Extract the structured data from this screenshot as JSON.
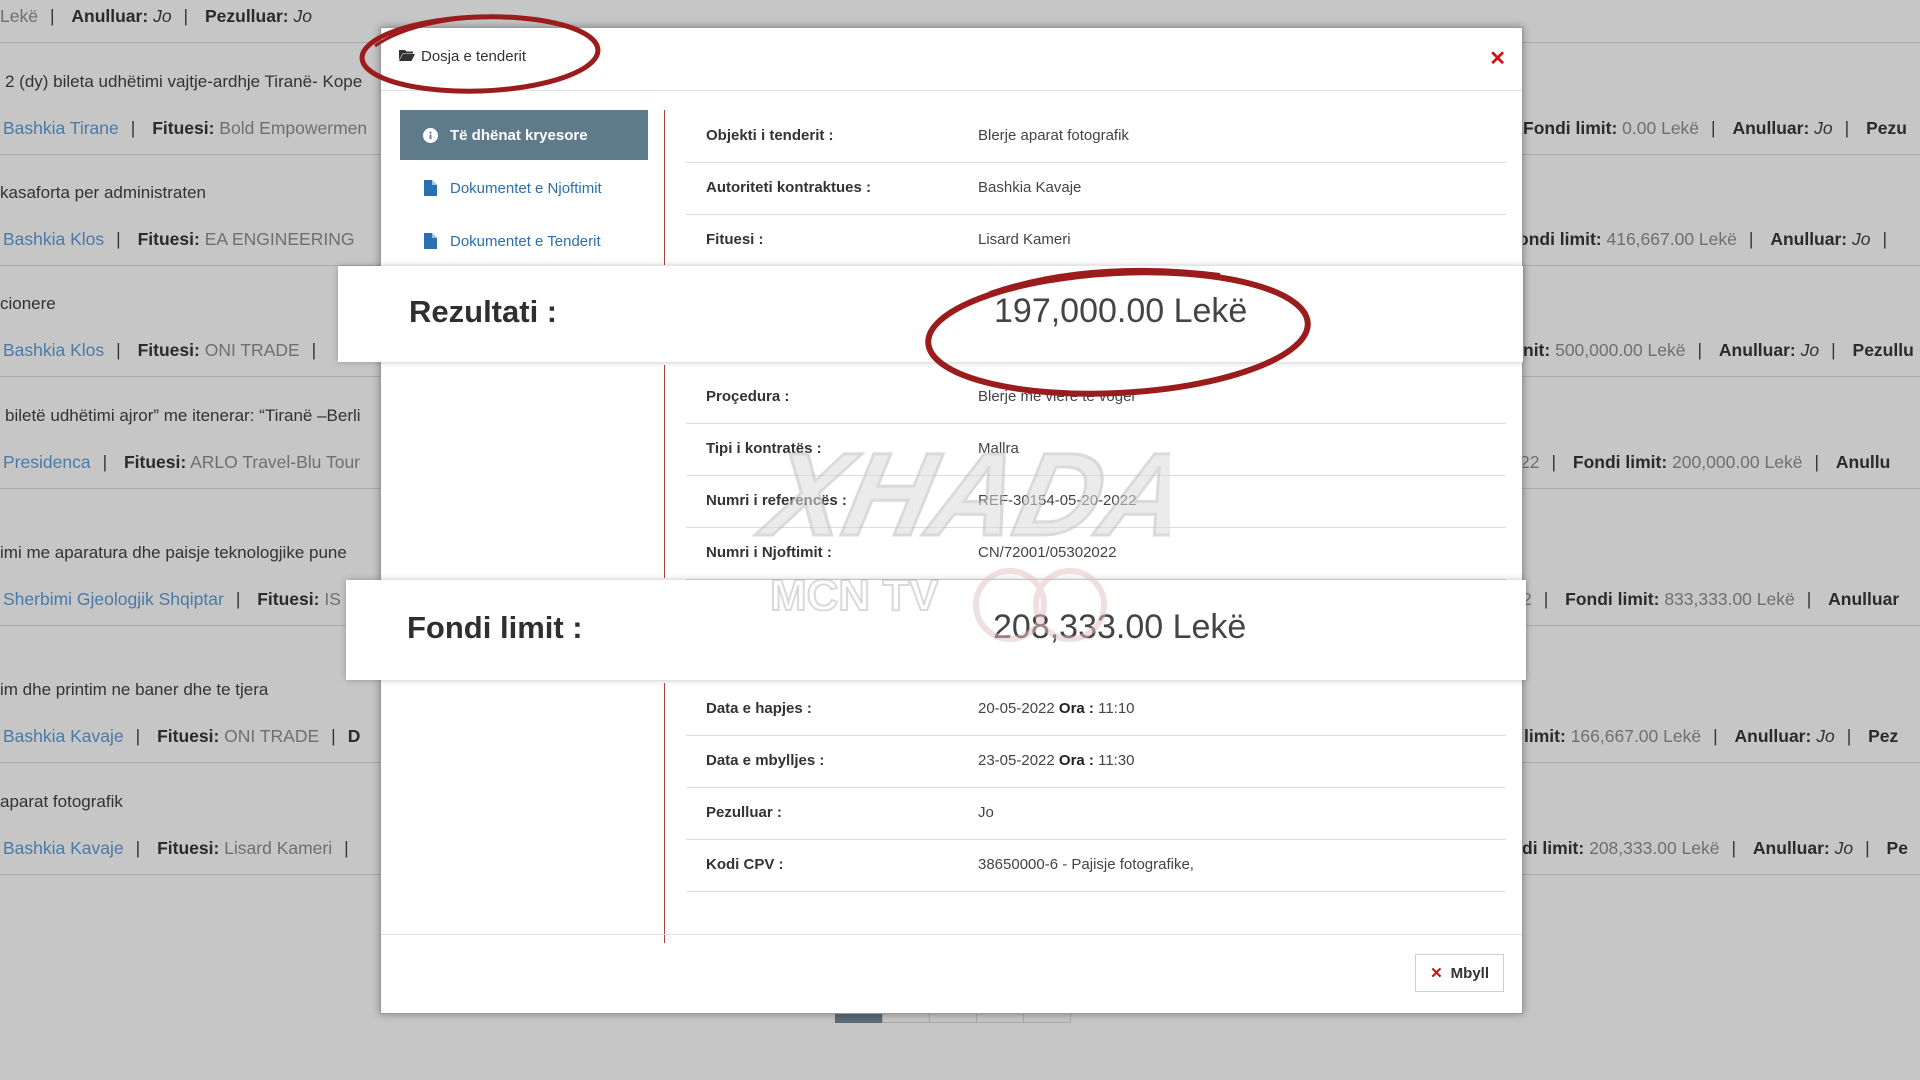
{
  "background": {
    "rows": [
      {
        "title": "",
        "authority": "",
        "winner": "",
        "meta_prefix": "Lekë",
        "anulluar_label": "Anulluar:",
        "anulluar_value": "Jo",
        "pezulluar_label": "Pezulluar:",
        "pezulluar_value": "Jo"
      },
      {
        "title": "2 (dy) bileta udhëtimi vajtje-ardhje Tiranë- Kope",
        "authority": "Bashkia Tirane",
        "winner_label": "Fituesi:",
        "winner": "Bold Empowermen",
        "fondi_label": "Fondi limit:",
        "fondi_value": "0.00 Lekë",
        "anulluar_label": "Anulluar:",
        "anulluar_value": "Jo",
        "pezulluar_label": "Pezu"
      },
      {
        "title": "kasaforta per administraten",
        "authority": "Bashkia Klos",
        "winner_label": "Fituesi:",
        "winner": "EA ENGINEERING",
        "fondi_label": "ondi limit:",
        "fondi_value": "416,667.00 Lekë",
        "anulluar_label": "Anulluar:",
        "anulluar_value": "Jo"
      },
      {
        "title": "cionere",
        "authority": "Bashkia Klos",
        "winner_label": "Fituesi:",
        "winner": "ONI TRADE",
        "fondi_label": "nit:",
        "fondi_value": "500,000.00 Lekë",
        "anulluar_label": "Anulluar:",
        "anulluar_value": "Jo",
        "pezulluar_label": "Pezullu"
      },
      {
        "title": "biletë udhëtimi ajror” me itenerar: “Tiranë –Berli",
        "authority": "Presidenca",
        "winner_label": "Fituesi:",
        "winner": "ARLO Travel-Blu Tour",
        "fondi_prefix": "22",
        "fondi_label": "Fondi limit:",
        "fondi_value": "200,000.00 Lekë",
        "anulluar_label": "Anullu"
      },
      {
        "title": "imi me aparatura dhe paisje teknologjike pune",
        "authority": "Sherbimi Gjeologjik Shqiptar",
        "winner_label": "Fituesi:",
        "winner": "IS",
        "fondi_prefix": "2",
        "fondi_label": "Fondi limit:",
        "fondi_value": "833,333.00 Lekë",
        "anulluar_label": "Anulluar"
      },
      {
        "title": "im dhe printim ne baner dhe te tjera",
        "authority": "Bashkia Kavaje",
        "winner_label": "Fituesi:",
        "winner": "ONI TRADE",
        "extra": "D",
        "fondi_label": "limit:",
        "fondi_value": "166,667.00 Lekë",
        "anulluar_label": "Anulluar:",
        "anulluar_value": "Jo",
        "pezulluar_label": "Pez"
      },
      {
        "title": "aparat fotografik",
        "authority": "Bashkia Kavaje",
        "winner_label": "Fituesi:",
        "winner": "Lisard Kameri",
        "fondi_label": "di limit:",
        "fondi_value": "208,333.00 Lekë",
        "anulluar_label": "Anulluar:",
        "anulluar_value": "Jo",
        "pezulluar_label": "Pe"
      }
    ]
  },
  "modal": {
    "title": "Dosja e tenderit",
    "close_glyph": "✕",
    "nav": [
      {
        "label": "Të dhënat kryesore",
        "icon": "info-circle-icon",
        "active": true
      },
      {
        "label": "Dokumentet e Njoftimit",
        "icon": "document-icon",
        "active": false
      },
      {
        "label": "Dokumentet e Tenderit",
        "icon": "document-icon",
        "active": false
      }
    ],
    "details_top": [
      {
        "label": "Objekti i tenderit :",
        "value": "Blerje aparat fotografik"
      },
      {
        "label": "Autoriteti kontraktues :",
        "value": "Bashkia Kavaje"
      },
      {
        "label": "Fituesi :",
        "value": "Lisard Kameri"
      }
    ],
    "details_mid": [
      {
        "label": "Proçedura :",
        "value": "Blerje me vlerë të vogël"
      },
      {
        "label": "Tipi i kontratës :",
        "value": "Mallra"
      },
      {
        "label": "Numri i referencës :",
        "value": "REF-30154-05-20-2022"
      },
      {
        "label": "Numri i Njoftimit :",
        "value": "CN/72001/05302022"
      }
    ],
    "details_bottom": [
      {
        "label": "Data e hapjes :",
        "date": "20-05-2022",
        "ora_label": "Ora :",
        "time": "11:10"
      },
      {
        "label": "Data e mbylljes :",
        "date": "23-05-2022",
        "ora_label": "Ora :",
        "time": "11:30"
      },
      {
        "label": "Pezulluar :",
        "value": "Jo"
      },
      {
        "label": "Kodi CPV :",
        "value": "38650000-6 - Pajisje fotografike,"
      }
    ],
    "close_button": "Mbyll"
  },
  "highlights": {
    "rezultati": {
      "label": "Rezultati :",
      "value": "197,000.00 Lekë"
    },
    "fondi": {
      "label": "Fondi limit :",
      "value": "208,333.00 Lekë"
    }
  },
  "watermark": {
    "text": "XHADAT",
    "subtext": "MCN TV"
  },
  "colors": {
    "accent_link": "#2a6fb0",
    "nav_active": "#5f7a8a",
    "close_red": "#d01010",
    "annotation_red": "#9b1c1c"
  }
}
